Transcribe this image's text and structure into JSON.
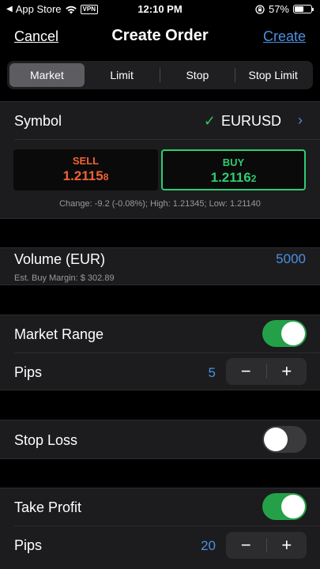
{
  "status_bar": {
    "back_label": "App Store",
    "vpn": "VPN",
    "time": "12:10 PM",
    "battery": "57%",
    "battery_level": 0.57
  },
  "nav": {
    "cancel": "Cancel",
    "title": "Create Order",
    "create": "Create"
  },
  "order_types": [
    {
      "label": "Market",
      "active": true
    },
    {
      "label": "Limit",
      "active": false
    },
    {
      "label": "Stop",
      "active": false
    },
    {
      "label": "Stop Limit",
      "active": false
    }
  ],
  "symbol": {
    "label": "Symbol",
    "value": "EURUSD"
  },
  "quotes": {
    "sell": {
      "label": "SELL",
      "price_main": "1.2115",
      "price_pip": "8"
    },
    "buy": {
      "label": "BUY",
      "price_main": "1.2116",
      "price_pip": "2"
    },
    "change_line": "Change: -9.2 (-0.08%); High: 1.21345; Low: 1.21140"
  },
  "volume": {
    "label": "Volume (EUR)",
    "value": "5000",
    "margin": "Est. Buy Margin: $ 302.89"
  },
  "market_range": {
    "label": "Market Range",
    "enabled": true,
    "pips_label": "Pips",
    "pips_value": "5",
    "minus": "−",
    "plus": "+"
  },
  "stop_loss": {
    "label": "Stop Loss",
    "enabled": false
  },
  "take_profit": {
    "label": "Take Profit",
    "enabled": true,
    "pips_label": "Pips",
    "pips_value": "20",
    "minus": "−",
    "plus": "+"
  },
  "colors": {
    "accent_blue": "#4a90e2",
    "sell_orange": "#f06236",
    "buy_green": "#2ecc71",
    "toggle_on": "#24a148"
  }
}
